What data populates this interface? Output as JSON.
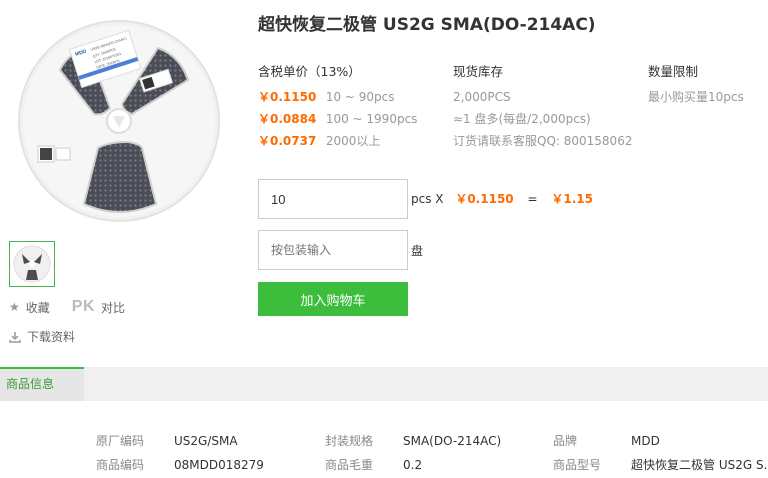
{
  "product": {
    "title": "超快恢复二极管 US2G SMA(DO-214AC)"
  },
  "reel_label": {
    "brand": "MDD",
    "lines": [
      "US2G SMA(DO-214AC)",
      "QTY: 2000PCS",
      "LOT: 2019071001",
      "DATE: 2019071"
    ]
  },
  "actions": {
    "favorite": "收藏",
    "pk": "PK",
    "compare": "对比",
    "download": "下载资料"
  },
  "pricing": {
    "header": "含税单价（13%）",
    "tiers": [
      {
        "price": "￥0.1150",
        "range": "10 ~ 90pcs"
      },
      {
        "price": "￥0.0884",
        "range": "100 ~ 1990pcs"
      },
      {
        "price": "￥0.0737",
        "range": "2000以上"
      }
    ]
  },
  "stock": {
    "header": "现货库存",
    "quantity": "2,000PCS",
    "reels": "≈1 盘多(每盘/2,000pcs)",
    "contact": "订货请联系客服QQ: 800158062"
  },
  "limit": {
    "header": "数量限制",
    "min_buy": "最小购买量10pcs"
  },
  "order": {
    "qty_value": "10",
    "pcs_x": "pcs X",
    "unit_price": "￥0.1150",
    "equals": "=",
    "total": "￥1.15",
    "pkg_placeholder": "按包装输入",
    "pkg_unit": "盘",
    "add_to_cart": "加入购物车"
  },
  "tabs": {
    "info": "商品信息"
  },
  "specs": [
    {
      "k": "原厂编码",
      "v": "US2G/SMA"
    },
    {
      "k": "封装规格",
      "v": "SMA(DO-214AC)"
    },
    {
      "k": "品牌",
      "v": "MDD"
    },
    {
      "k": "商品编码",
      "v": "08MDD018279"
    },
    {
      "k": "商品毛重",
      "v": "0.2"
    },
    {
      "k": "商品型号",
      "v": "超快恢复二极管 US2G S."
    }
  ],
  "colors": {
    "accent_green": "#3cbd3c",
    "price_orange": "#ff6a00"
  }
}
